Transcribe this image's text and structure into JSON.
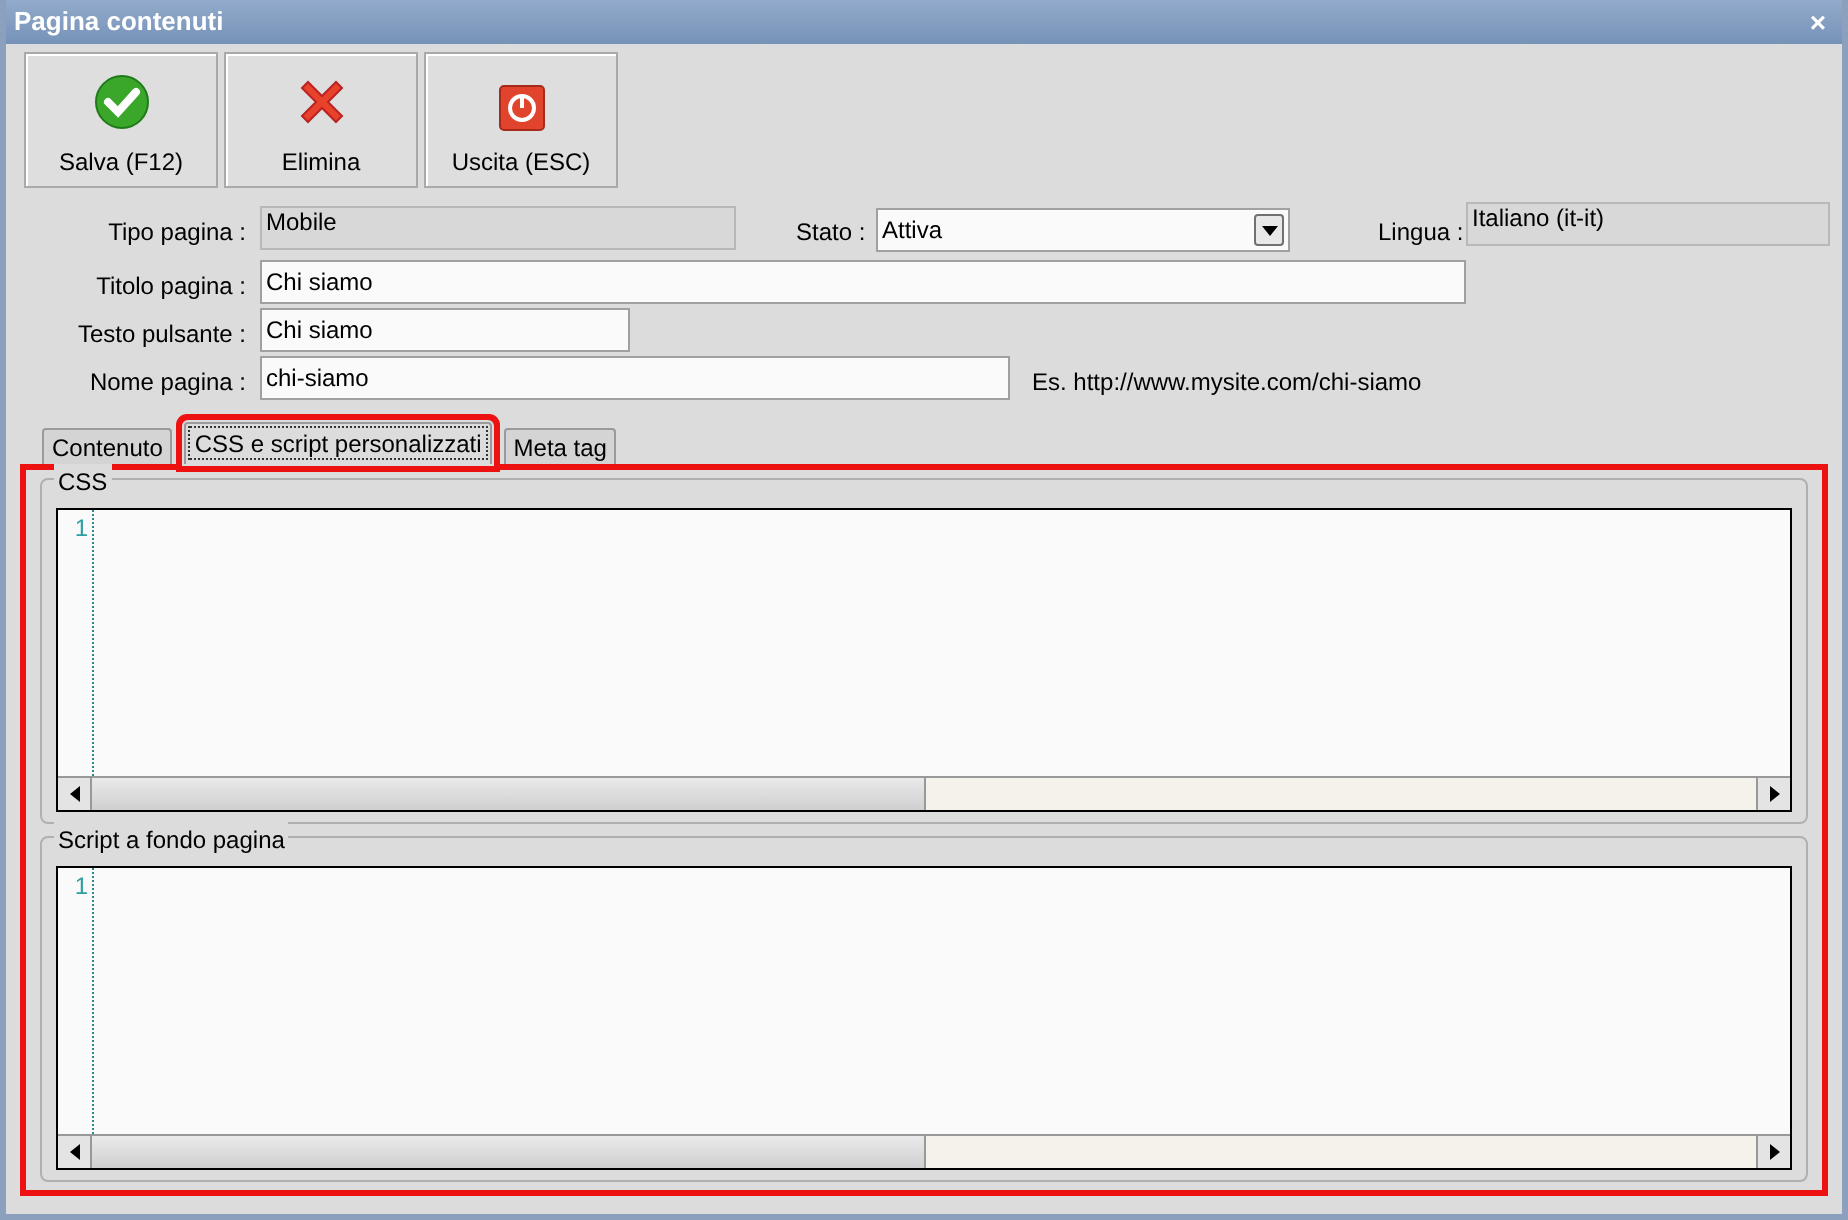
{
  "window": {
    "title": "Pagina contenuti",
    "close": "×"
  },
  "toolbar": [
    {
      "kind": "save",
      "label": "Salva (F12)"
    },
    {
      "kind": "delete",
      "label": "Elimina"
    },
    {
      "kind": "exit",
      "label": "Uscita (ESC)"
    }
  ],
  "form": {
    "tipo_pagina": {
      "label": "Tipo pagina :",
      "value": "Mobile",
      "disabled": true
    },
    "stato": {
      "label": "Stato :",
      "value": "Attiva"
    },
    "lingua": {
      "label": "Lingua :",
      "value": "Italiano (it-it)",
      "disabled": true
    },
    "titolo_pagina": {
      "label": "Titolo pagina :",
      "value": "Chi siamo"
    },
    "testo_pulsante": {
      "label": "Testo pulsante :",
      "value": "Chi siamo"
    },
    "nome_pagina": {
      "label": "Nome pagina :",
      "value": "chi-siamo",
      "hint": "Es. http://www.mysite.com/chi-siamo"
    }
  },
  "tabs": [
    {
      "label": "Contenuto",
      "selected": false,
      "highlighted": false
    },
    {
      "label": "CSS e script personalizzati",
      "selected": true,
      "highlighted": true
    },
    {
      "label": "Meta tag",
      "selected": false,
      "highlighted": false
    }
  ],
  "panel": {
    "highlighted": true,
    "groups": [
      {
        "title": "CSS",
        "line_numbers": [
          "1"
        ]
      },
      {
        "title": "Script a fondo pagina",
        "line_numbers": [
          "1"
        ]
      }
    ]
  }
}
